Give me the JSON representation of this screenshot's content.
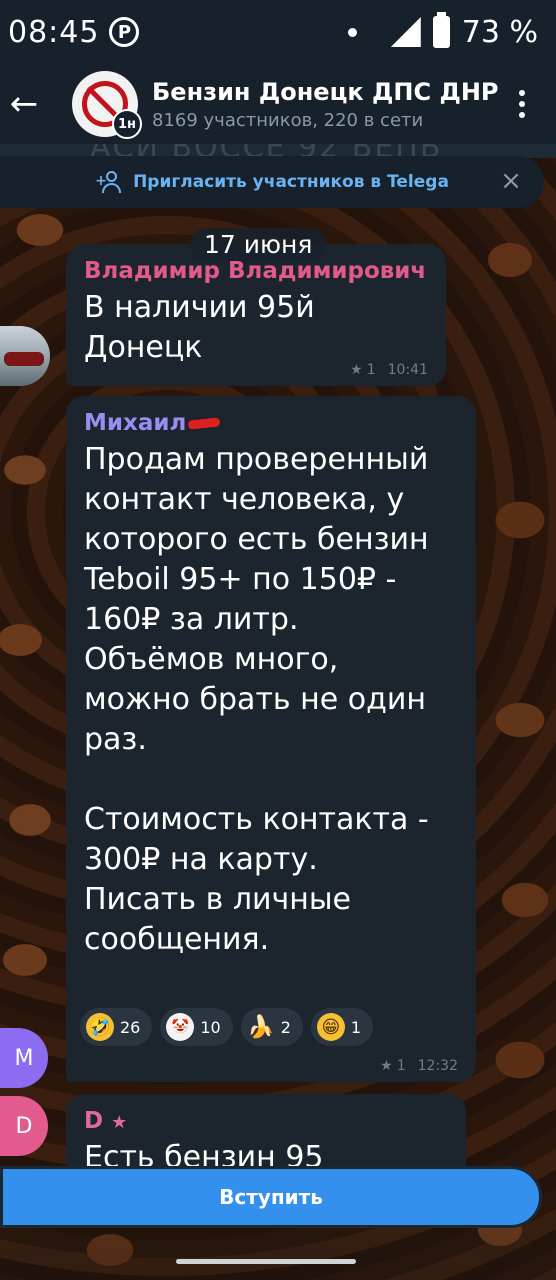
{
  "status_bar": {
    "time": "08:45",
    "app_icon": "P",
    "battery": "73 %"
  },
  "header": {
    "title": "Бензин Донецк ДПС ДНР",
    "subtitle": "8169 участников, 220 в сети",
    "timer_badge": "1н"
  },
  "pinned": {
    "ghost_text": "АСИ ВОССЕ 92 ВЕПБ"
  },
  "invite": {
    "label": "Пригласить участников в Telega",
    "close": "×"
  },
  "date_pill": "17 июня",
  "messages": [
    {
      "sender": "Владимир Владимирович",
      "text": "В наличии 95й\nДонецк",
      "views": "1",
      "time": "10:41"
    },
    {
      "sender": "Михаил",
      "text": "Продам проверенный\nконтакт человека, у\nкоторого есть бензин\nTeboil 95+ по 150₽ -\n160₽ за литр.\nОбъёмов много,\nможно брать не один\nраз.\n\nСтоимость контакта -\n300₽ на карту.\nПисать в личные\nсообщения.",
      "views": "1",
      "time": "12:32",
      "reactions": [
        {
          "emoji": "🤣",
          "count": "26"
        },
        {
          "emoji": "🤡",
          "count": "10"
        },
        {
          "emoji": "🍌",
          "count": "2"
        },
        {
          "emoji": "😁",
          "count": "1"
        }
      ]
    },
    {
      "sender": "D",
      "text": "Есть бензин 95"
    }
  ],
  "avatars": {
    "m": "M",
    "d": "D"
  },
  "join_button": "Вступить",
  "colors": {
    "accent": "#3390ec",
    "bubble": "#1c242e",
    "header": "#17212b",
    "link": "#6ab3f3"
  }
}
